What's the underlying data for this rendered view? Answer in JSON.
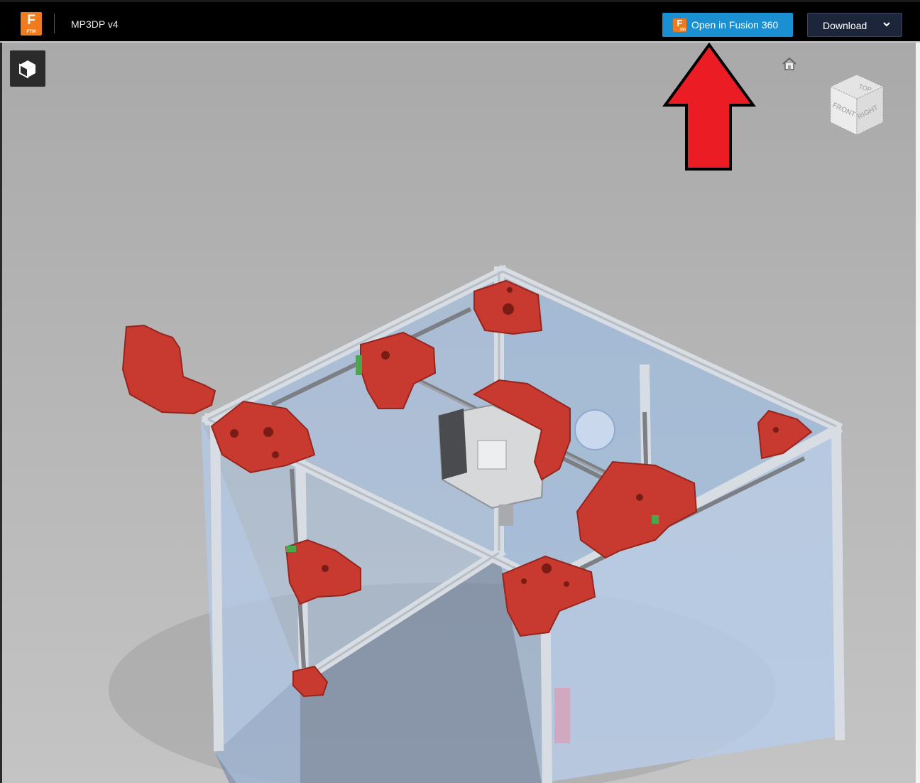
{
  "header": {
    "logo_letter": "F",
    "logo_sub": "FTM",
    "doc_title": "MP3DP v4",
    "open_button_label": "Open in Fusion 360",
    "fusion_icon_letter": "F",
    "fusion_icon_sub": "360",
    "download_label": "Download"
  },
  "viewport": {
    "viewcube_faces": {
      "top": "TOP",
      "front": "FRONT",
      "right": "RIGHT"
    },
    "annotation": "red-arrow-pointing-up"
  },
  "colors": {
    "accent_blue": "#1a8fd1",
    "fusion_orange": "#f07a1c",
    "download_bg": "#1c2539",
    "part_red": "#c8392f",
    "panel_blue": "#a9c4e4",
    "arrow_red": "#ec1c24"
  },
  "icons": [
    "fusion-logo-icon",
    "cube-view-icon",
    "home-icon",
    "viewcube-icon",
    "chevron-down-icon"
  ]
}
